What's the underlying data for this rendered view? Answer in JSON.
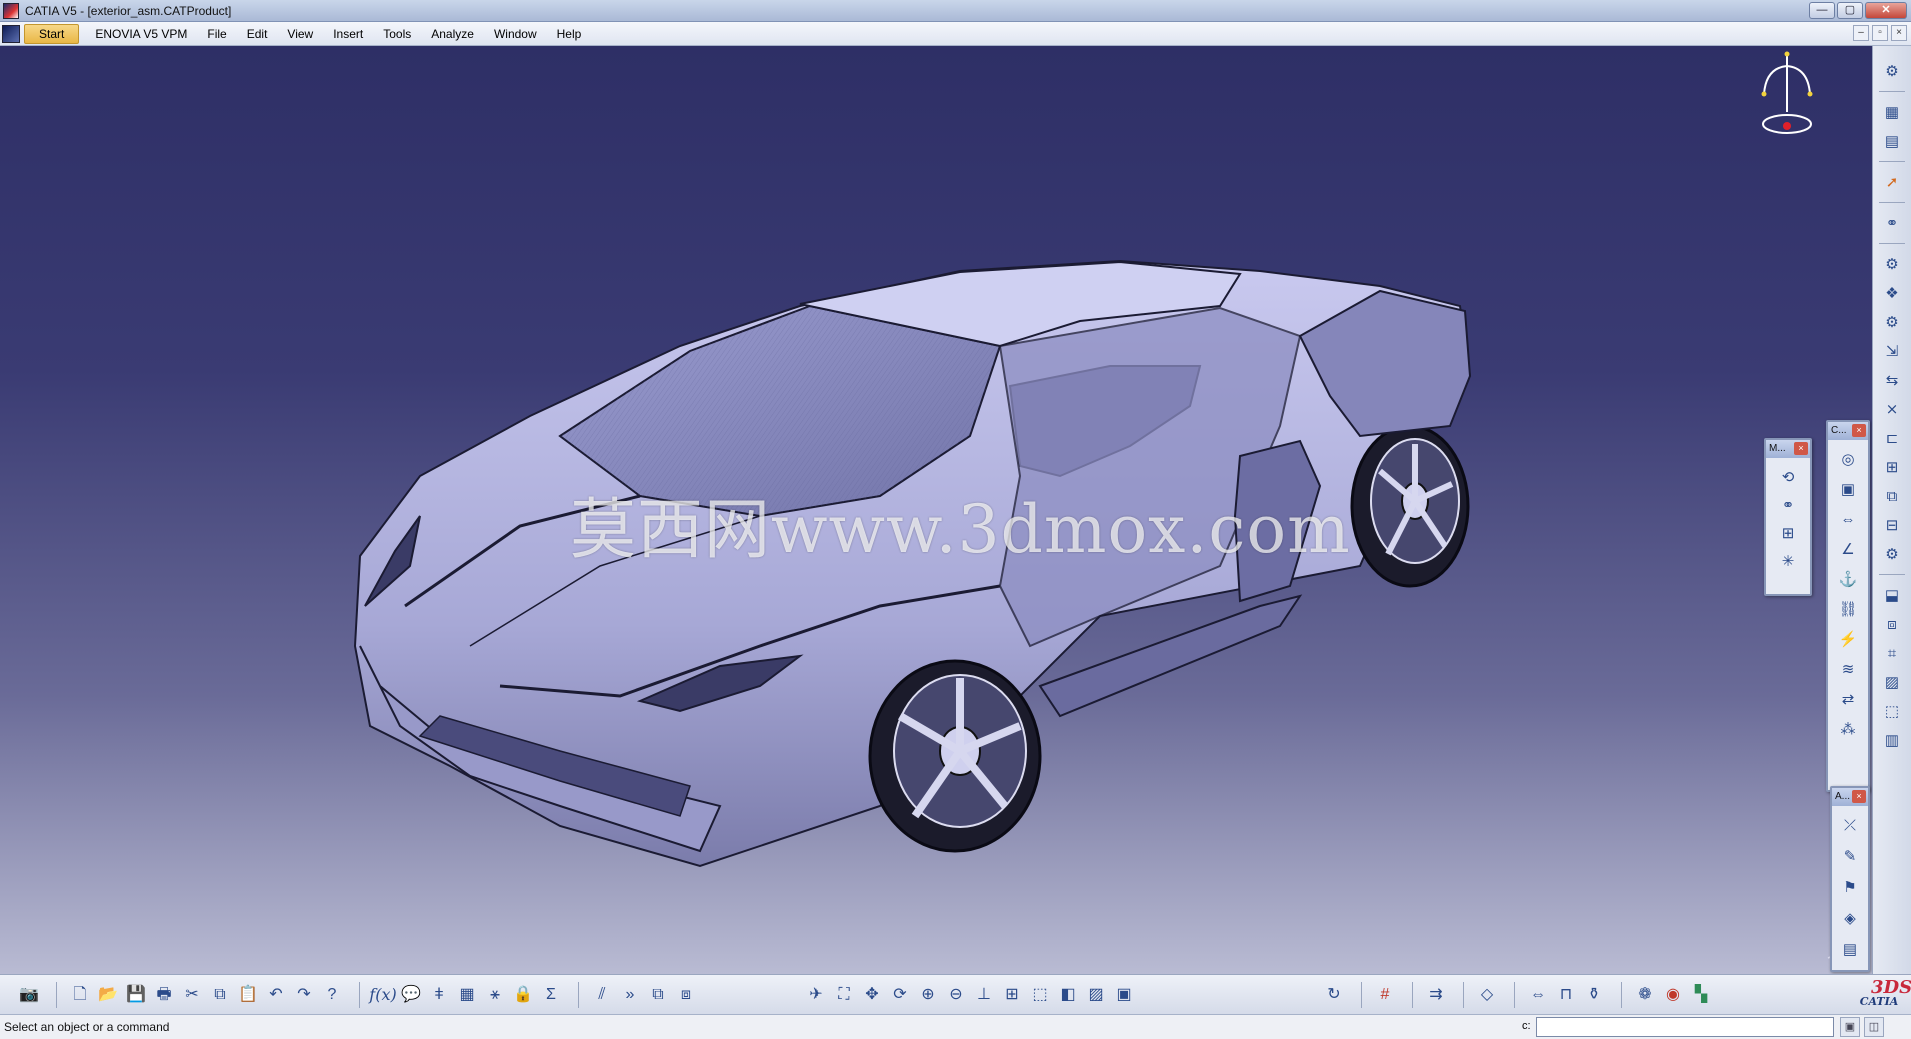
{
  "window": {
    "title": "CATIA V5 - [exterior_asm.CATProduct]",
    "min_label": "—",
    "max_label": "▢",
    "close_label": "✕"
  },
  "menu": {
    "items": [
      "Start",
      "ENOVIA V5 VPM",
      "File",
      "Edit",
      "View",
      "Insert",
      "Tools",
      "Analyze",
      "Window",
      "Help"
    ]
  },
  "doc_controls": {
    "min": "–",
    "restore": "▫",
    "close": "×"
  },
  "viewport": {
    "watermark": "莫西网www.3dmox.com"
  },
  "floating_toolbars": {
    "m_title": "M...",
    "c_title": "C...",
    "a_title": "A...",
    "close_label": "×"
  },
  "status": {
    "message": "Select an object or a command",
    "command_label": "c:",
    "command_value": ""
  },
  "branding": {
    "logo_text": "CATIA",
    "logo_mark": "3DS"
  },
  "colors": {
    "viewport_top": "#2e2f66",
    "viewport_bottom": "#b9bbd3",
    "car_body": "#a9aad8",
    "car_shadow": "#6a6a9e",
    "start_button": "#e9b746"
  },
  "icons": {
    "right_toolbar": [
      "gears-icon",
      "tree-icon",
      "tree2-icon",
      "select-arrow-icon",
      "snap-icon",
      "component-icon",
      "product-icon",
      "part-icon",
      "existing-component-icon",
      "replace-icon",
      "renumber-icon",
      "constraint-icon",
      "reorder-icon",
      "multi-instance-icon",
      "publish-icon",
      "explode-icon",
      "stop-icon",
      "update-icon",
      "measure-icon",
      "space-analysis-icon",
      "scene-icon",
      "catalog-icon",
      "library-icon"
    ],
    "bottom_toolbar": [
      "camera-icon",
      "new-icon",
      "open-icon",
      "save-icon",
      "print-icon",
      "cut-icon",
      "copy-icon",
      "paste-icon",
      "undo-icon",
      "redo-icon",
      "whats-this-icon",
      "formula-icon",
      "comment-icon",
      "knowledge-icon",
      "table-icon",
      "graph-icon",
      "lock-icon",
      "sigma-icon",
      "split-icon",
      "arrow-right-icon",
      "snap-icon",
      "swap-icon",
      "fly-icon",
      "fit-all-icon",
      "pan-icon",
      "rotate-icon",
      "zoom-in-icon",
      "zoom-out-icon",
      "normal-view-icon",
      "multi-view-icon",
      "views-icon",
      "render-style-icon",
      "hide-show-icon",
      "swap-visible-icon",
      "refresh-icon",
      "grid-icon",
      "publish-icon",
      "clash-icon",
      "distance-icon",
      "pipe-icon",
      "bottle-icon",
      "catalog-icon",
      "sphere-icon",
      "layers-icon"
    ]
  }
}
